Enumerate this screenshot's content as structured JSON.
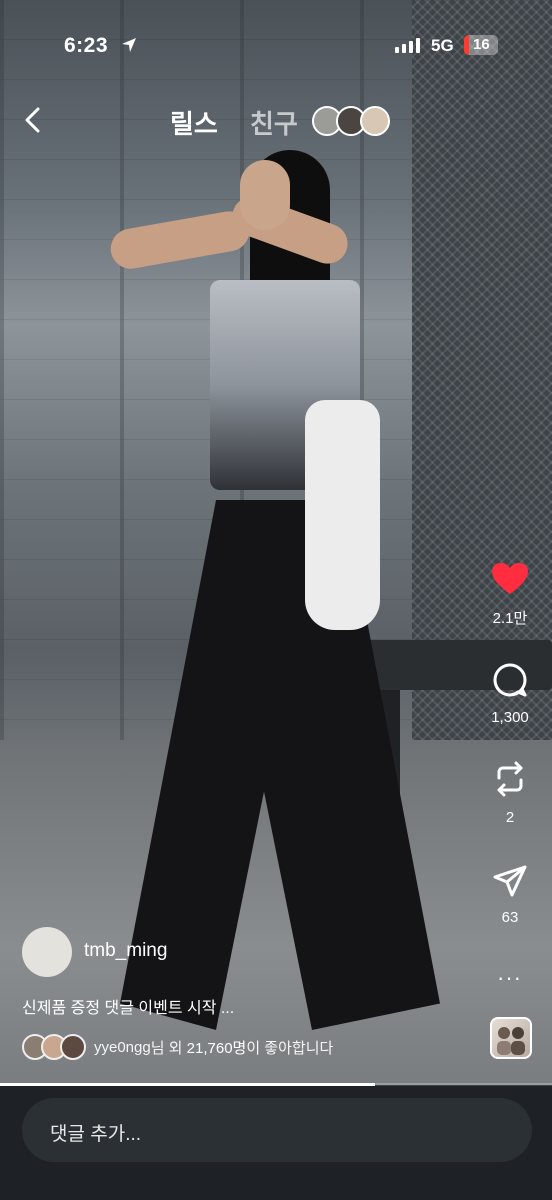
{
  "status_bar": {
    "time": "6:23",
    "network": "5G",
    "battery": "16"
  },
  "header": {
    "tabs": [
      "릴스",
      "친구"
    ]
  },
  "actions": {
    "like_count": "2.1만",
    "comment_count": "1,300",
    "repost_count": "2",
    "share_count": "63",
    "more_label": "···"
  },
  "post": {
    "author": "tmb_ming",
    "caption": "신제품 증정 댓글 이벤트 시작 ...",
    "likes_user": "yye0ngg",
    "likes_mid": "님 외 ",
    "likes_count": "21,760명",
    "likes_suffix": "이 좋아합니다"
  },
  "progress": 0.68,
  "comment": {
    "placeholder": "댓글 추가..."
  },
  "colors": {
    "like_red": "#ff2d3f",
    "bottom_bar": "#1e2226"
  }
}
